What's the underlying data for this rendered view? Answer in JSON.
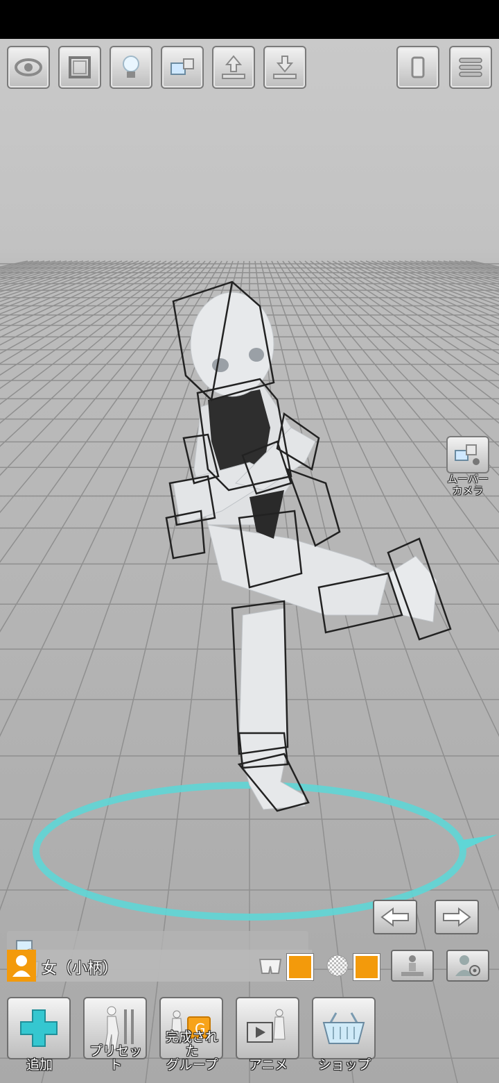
{
  "toolbar": {
    "buttons": [
      {
        "name": "eye-icon"
      },
      {
        "name": "frame-icon"
      },
      {
        "name": "light-bulb-icon"
      },
      {
        "name": "camera-icon"
      },
      {
        "name": "upload-icon"
      },
      {
        "name": "download-icon"
      }
    ],
    "right_buttons": [
      {
        "name": "phone-icon"
      },
      {
        "name": "menu-icon"
      }
    ]
  },
  "mover_camera": {
    "label_line1": "ムーバー",
    "label_line2": "カメラ"
  },
  "model": {
    "name": "女（小柄）",
    "costume_color": "#f39a0b",
    "texture_color": "#f39a0b"
  },
  "bottom_nav": {
    "items": [
      {
        "label": "追加",
        "icon": "plus-icon"
      },
      {
        "label": "プリセット",
        "icon": "preset-pose-icon"
      },
      {
        "label": "完成された\nグループ",
        "icon": "group-icon"
      },
      {
        "label": "アニメ",
        "icon": "anime-icon"
      },
      {
        "label": "ショップ",
        "icon": "shop-basket-icon"
      }
    ]
  },
  "colors": {
    "accent": "#f39a0b",
    "ring": "#5fd6d6",
    "plus": "#35c7d0"
  }
}
